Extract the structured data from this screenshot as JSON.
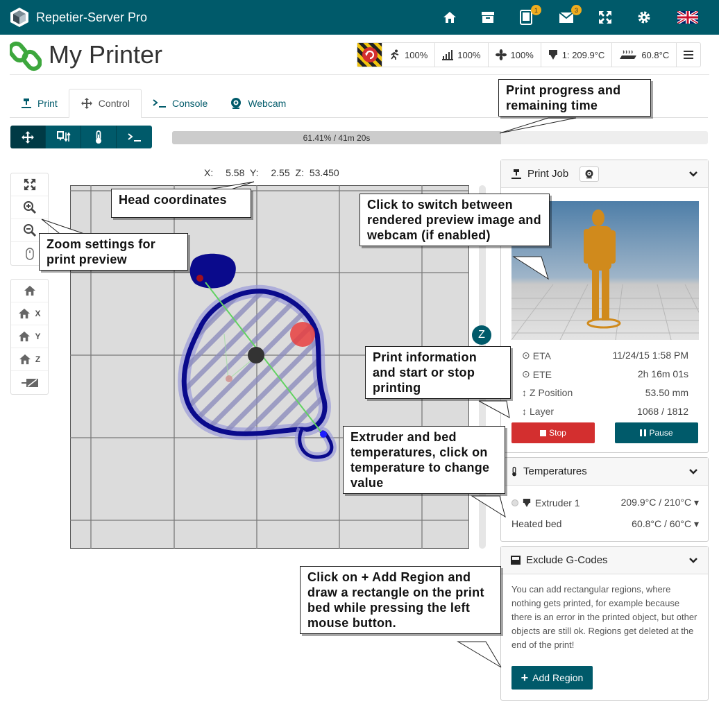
{
  "app": {
    "title": "Repetier-Server Pro"
  },
  "topbar": {
    "icons": [
      "home-icon",
      "archive-icon",
      "tablet-icon",
      "mail-icon",
      "fullscreen-icon",
      "gear-icon",
      "flag-uk-icon"
    ],
    "tablet_badge": "1",
    "mail_badge": "3"
  },
  "page": {
    "title": "My Printer"
  },
  "status": {
    "speed": "100%",
    "flow": "100%",
    "fan": "100%",
    "extruder": "1: 209.9°C",
    "bed": "60.8°C"
  },
  "tabs": [
    {
      "label": "Print"
    },
    {
      "label": "Control"
    },
    {
      "label": "Console"
    },
    {
      "label": "Webcam"
    }
  ],
  "progress": {
    "text": "61.41% / 41m 20s",
    "percent": 61.41
  },
  "coords": {
    "x_label": "X:",
    "x": "5.58",
    "y_label": "Y:",
    "y": "2.55",
    "z_label": "Z:",
    "z": "53.450"
  },
  "home_buttons": [
    "X",
    "Y",
    "Z"
  ],
  "z_slider": {
    "label": "Z"
  },
  "print_job": {
    "title": "Print Job",
    "eta_label": "ETA",
    "eta": "11/24/15 1:58 PM",
    "ete_label": "ETE",
    "ete": "2h 16m 01s",
    "zpos_label": "Z Position",
    "zpos": "53.50 mm",
    "layer_label": "Layer",
    "layer": "1068 / 1812",
    "stop": "Stop",
    "pause": "Pause"
  },
  "temperatures": {
    "title": "Temperatures",
    "extruder_label": "Extruder 1",
    "extruder_value": "209.9°C / 210°C",
    "bed_label": "Heated bed",
    "bed_value": "60.8°C / 60°C"
  },
  "exclude": {
    "title": "Exclude G-Codes",
    "description": "You can add rectangular regions, where nothing gets printed, for example because there is an error in the printed object, but other objects are still ok. Regions get deleted at the end of the print!",
    "add_button": "Add Region"
  },
  "callouts": {
    "progress": "Print progress and remaining time",
    "coords": "Head coordinates",
    "zoom": "Zoom settings for print preview",
    "preview": "Click to switch between rendered preview image and webcam (if enabled)",
    "printinfo": "Print information and start or stop printing",
    "temps": "Extruder and bed temperatures, click on temperature to change value",
    "region": "Click on + Add Region and draw a rectangle on the print bed while pressing the left mouse button."
  },
  "colors": {
    "brand": "#005a6a",
    "stop": "#d32f2f",
    "path": "#0a0a8c",
    "badge": "#f0ad1d"
  }
}
